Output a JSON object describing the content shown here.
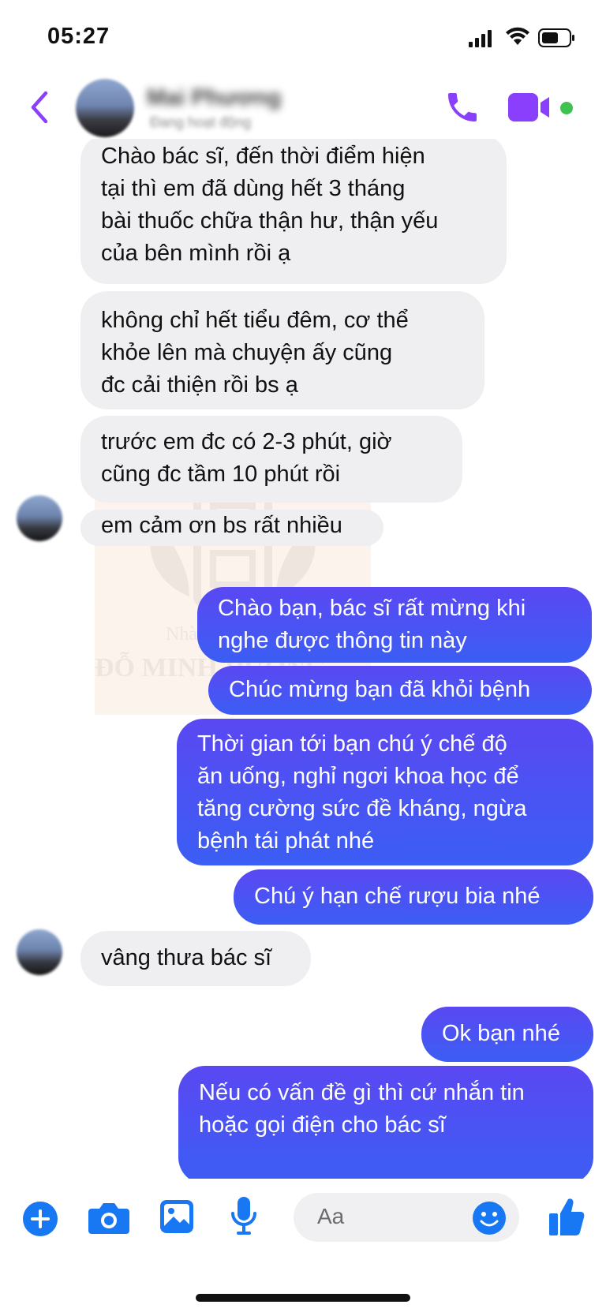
{
  "status_bar": {
    "time": "05:27",
    "icons": [
      "cellular-signal-icon",
      "wifi-icon",
      "battery-icon"
    ]
  },
  "header": {
    "contact_name": "Mai Phương",
    "contact_status": "Đang hoạt động",
    "icons": [
      "back-chevron-icon",
      "phone-call-icon",
      "video-call-icon"
    ],
    "accent_color": "#8a3ffc",
    "online_color": "#3fc24f"
  },
  "messages": [
    {
      "side": "in",
      "text": "Chào bác sĩ, đến thời điểm hiện\ntại thì em đã dùng hết 3 tháng\nbài thuốc chữa thận hư, thận yếu\ncủa bên mình rồi ạ"
    },
    {
      "side": "in",
      "text": "không chỉ hết tiểu đêm, cơ thể\nkhỏe lên mà chuyện ấy cũng\nđc cải thiện rồi bs ạ"
    },
    {
      "side": "in",
      "text": "trước em đc có 2-3 phút, giờ\ncũng đc tầm 10 phút rồi"
    },
    {
      "side": "in",
      "text": "em cảm ơn bs rất nhiều"
    },
    {
      "side": "out",
      "text": "Chào bạn, bác sĩ rất mừng khi\nnghe được thông tin này"
    },
    {
      "side": "out",
      "text": "Chúc mừng bạn đã khỏi bệnh"
    },
    {
      "side": "out",
      "text": "Thời gian tới bạn chú ý chế độ\năn uống, nghỉ ngơi khoa học để\ntăng cường sức đề kháng, ngừa\nbệnh tái phát nhé"
    },
    {
      "side": "out",
      "text": "Chú ý hạn chế rượu bia nhé"
    },
    {
      "side": "in",
      "text": "vâng thưa bác sĩ"
    },
    {
      "side": "out",
      "text": "Ok bạn nhé"
    },
    {
      "side": "out",
      "text": "Nếu có vấn đề gì thì cứ nhắn tin\nhoặc gọi điện cho bác sĩ"
    }
  ],
  "watermark": {
    "line1": "Nhà thuốc",
    "line2": "ĐỖ MINH ĐƯỜNG"
  },
  "composer": {
    "placeholder": "Aa",
    "icons": [
      "add-icon",
      "camera-icon",
      "image-gallery-icon",
      "microphone-icon",
      "emoji-icon",
      "thumbs-up-icon"
    ],
    "icon_color": "#1877f2"
  },
  "colors": {
    "incoming_bubble": "#efeff1",
    "outgoing_bubble": "#4a54f5"
  }
}
